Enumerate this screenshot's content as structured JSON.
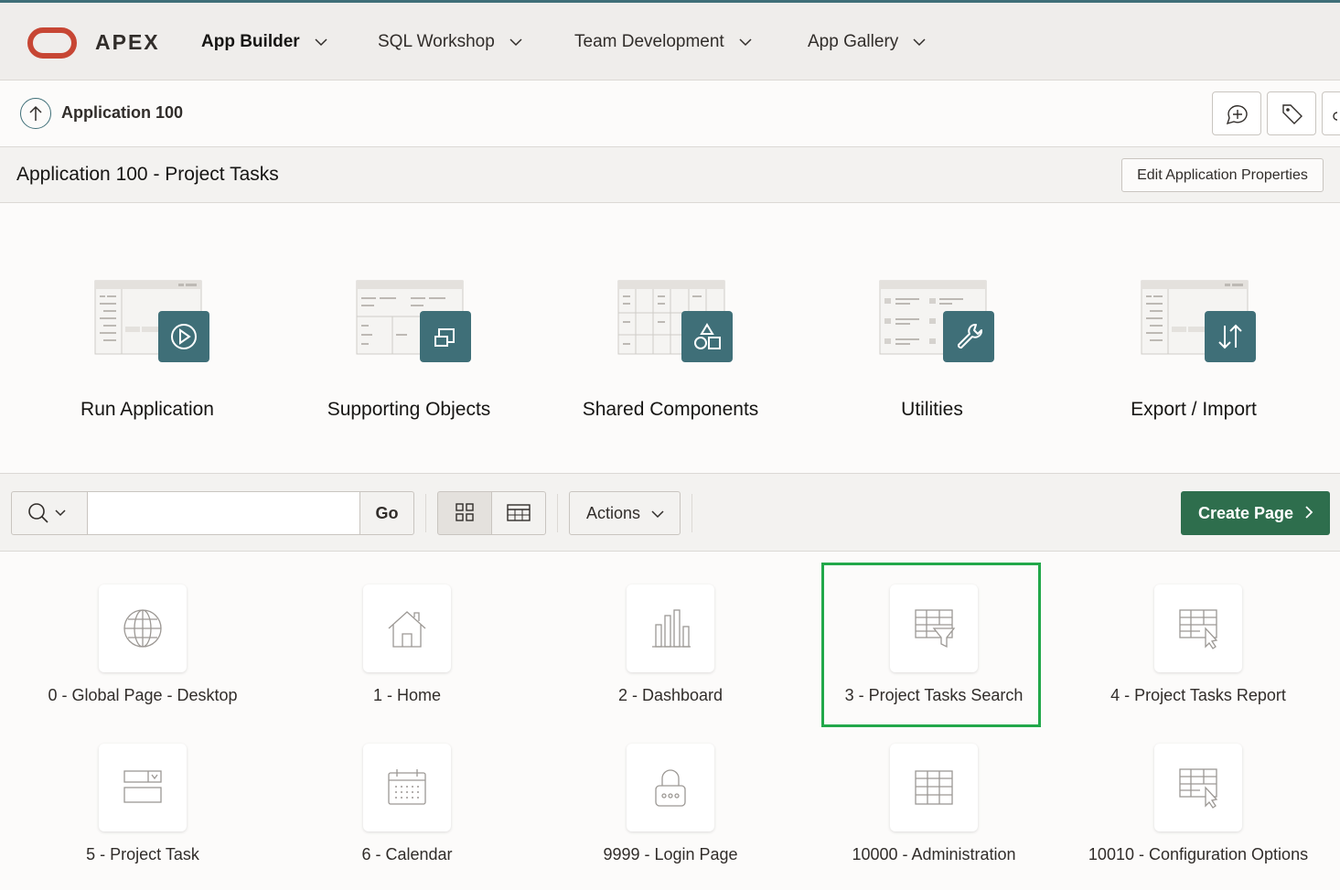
{
  "topnav": {
    "logo_text": "APEX",
    "items": [
      "App Builder",
      "SQL Workshop",
      "Team Development",
      "App Gallery"
    ]
  },
  "breadcrumb": {
    "label": "Application 100"
  },
  "title": {
    "text": "Application 100 - Project Tasks",
    "edit_button": "Edit Application Properties"
  },
  "tiles": [
    {
      "label": "Run Application",
      "icon": "play-icon"
    },
    {
      "label": "Supporting Objects",
      "icon": "scroll-icon"
    },
    {
      "label": "Shared Components",
      "icon": "shapes-icon"
    },
    {
      "label": "Utilities",
      "icon": "wrench-icon"
    },
    {
      "label": "Export / Import",
      "icon": "arrows-icon"
    }
  ],
  "toolbar": {
    "search_value": "",
    "go_label": "Go",
    "actions_label": "Actions",
    "create_label": "Create Page",
    "view_selected": "grid"
  },
  "pages": [
    {
      "label": "0 - Global Page - Desktop",
      "icon": "globe-icon"
    },
    {
      "label": "1 - Home",
      "icon": "home-icon"
    },
    {
      "label": "2 - Dashboard",
      "icon": "bar-chart-icon"
    },
    {
      "label": "3 - Project Tasks Search",
      "icon": "filter-grid-icon",
      "highlighted": true
    },
    {
      "label": "4 - Project Tasks Report",
      "icon": "report-icon"
    },
    {
      "label": "5 - Project Task",
      "icon": "form-icon"
    },
    {
      "label": "6 - Calendar",
      "icon": "calendar-icon"
    },
    {
      "label": "9999 - Login Page",
      "icon": "lock-icon"
    },
    {
      "label": "10000 - Administration",
      "icon": "grid-icon"
    },
    {
      "label": "10010 - Configuration Options",
      "icon": "report-icon"
    }
  ],
  "colors": {
    "brand": "#c74634",
    "accent": "#3f6f78",
    "create": "#2e6e4d",
    "highlight": "#22a84a"
  }
}
